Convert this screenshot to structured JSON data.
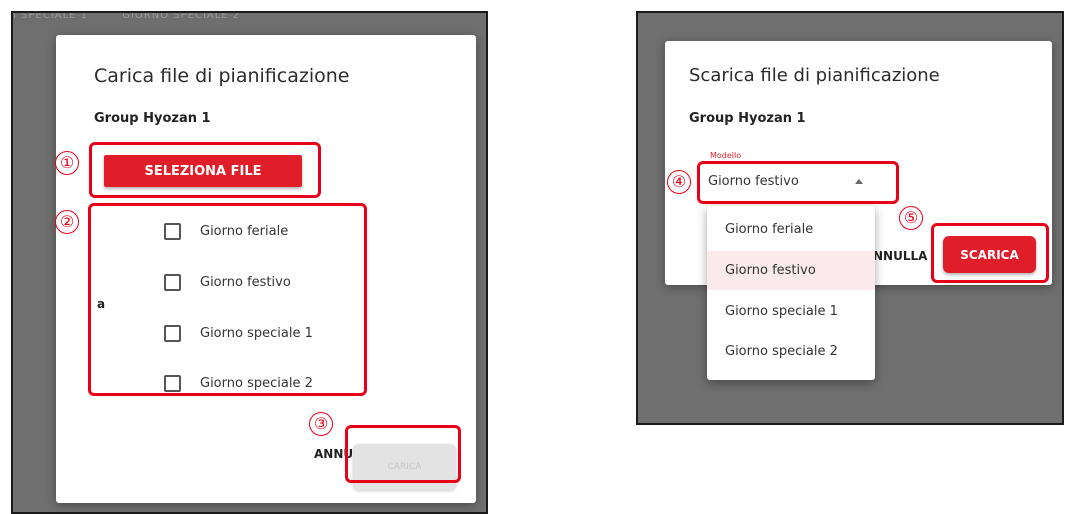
{
  "upload_dialog": {
    "background_tabs": [
      "I SPECIALE 1",
      "GIORNO SPECIALE 2"
    ],
    "title": "Carica file di pianificazione",
    "group": "Group Hyozan 1",
    "select_file_button": "SELEZIONA FILE",
    "to_label": "a",
    "day_types": [
      {
        "label": "Giorno feriale",
        "checked": false
      },
      {
        "label": "Giorno festivo",
        "checked": false
      },
      {
        "label": "Giorno speciale 1",
        "checked": false
      },
      {
        "label": "Giorno speciale 2",
        "checked": false
      }
    ],
    "cancel_button": "ANNULLA",
    "upload_button": "CARICA"
  },
  "download_dialog": {
    "title": "Scarica file di pianificazione",
    "group": "Group Hyozan 1",
    "model_label": "Modello",
    "model_value": "Giorno festivo",
    "model_options": [
      "Giorno feriale",
      "Giorno festivo",
      "Giorno speciale 1",
      "Giorno speciale 2"
    ],
    "cancel_button_partial": "NNULLA",
    "download_button": "SCARICA"
  },
  "annotations": {
    "marker_1": "①",
    "marker_2": "②",
    "marker_3": "③",
    "marker_4": "④",
    "marker_5": "⑤",
    "color": "#e8001a"
  },
  "colors": {
    "accent": "#e01e2a",
    "overlay": "#6f6f6f",
    "selected_option_bg": "#fbeaec"
  }
}
